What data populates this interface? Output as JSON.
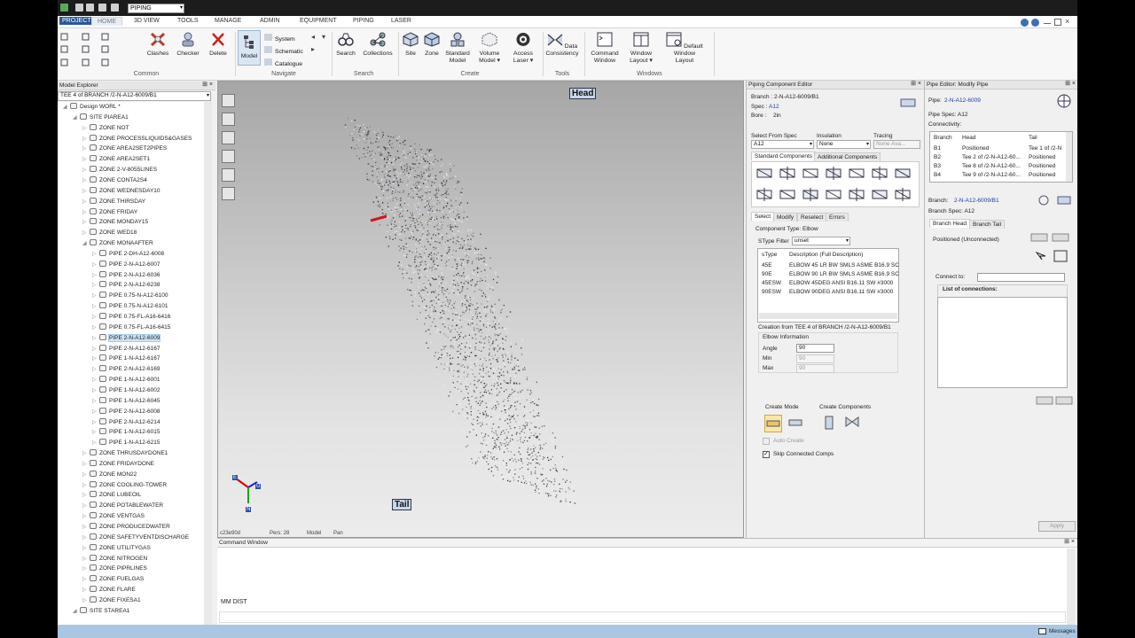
{
  "titlebar": {
    "project": "PIPING"
  },
  "menu": {
    "items": [
      "PROJECT",
      "HOME",
      "3D VIEW",
      "TOOLS",
      "MANAGE",
      "ADMIN",
      "EQUIPMENT",
      "PIPING",
      "LASER"
    ]
  },
  "ribbon": {
    "common_group": "Common",
    "navigate_group": "Navigate",
    "search_group": "Search",
    "create_group": "Create",
    "tools_group": "Tools",
    "windows_group": "Windows",
    "clashes": "Clashes",
    "checker": "Checker",
    "delete": "Delete",
    "model": "Model",
    "system": "System",
    "schematic": "Schematic",
    "catalogue": "Catalogue",
    "search": "Search",
    "collections": "Collections",
    "site": "Site",
    "zone": "Zone",
    "standard_model_1": "Standard",
    "standard_model_2": "Model",
    "volume_model_1": "Volume",
    "volume_model_2": "Model ▾",
    "access_laser_1": "Access",
    "access_laser_2": "Laser ▾",
    "data_consistency_1": "Data",
    "data_consistency_2": "Consistency",
    "command_window_1": "Command",
    "command_window_2": "Window",
    "window_layout_1": "Window",
    "window_layout_2": "Layout ▾",
    "default_window_layout_1": "Default Window",
    "default_window_layout_2": "Layout"
  },
  "explorer": {
    "title": "Model Explorer",
    "path": "TEE 4 of BRANCH /2-N-A12-6009/B1",
    "nodes": [
      {
        "label": "Design WORL *",
        "level": 0
      },
      {
        "label": "SITE PIAREA1",
        "level": 1
      },
      {
        "label": "ZONE NOT",
        "level": 2
      },
      {
        "label": "ZONE PROCESSLIQUIDS&GASES",
        "level": 2
      },
      {
        "label": "ZONE AREA2SET2PIPES",
        "level": 2
      },
      {
        "label": "ZONE AREA2SET1",
        "level": 2
      },
      {
        "label": "ZONE 2-V-8055LINES",
        "level": 2
      },
      {
        "label": "ZONE CONTA2S4",
        "level": 2
      },
      {
        "label": "ZONE WEDNESDAY10",
        "level": 2
      },
      {
        "label": "ZONE THIRSDAY",
        "level": 2
      },
      {
        "label": "ZONE FRIDAY",
        "level": 2
      },
      {
        "label": "ZONE MONDAY15",
        "level": 2
      },
      {
        "label": "ZONE WED18",
        "level": 2
      },
      {
        "label": "ZONE MONAAFTER",
        "level": 2
      },
      {
        "label": "PIPE 2-DH-A12-6008",
        "level": 3
      },
      {
        "label": "PIPE 2-N-A12-6007",
        "level": 3
      },
      {
        "label": "PIPE 2-N-A12-6036",
        "level": 3
      },
      {
        "label": "PIPE 2-N-A12-6238",
        "level": 3
      },
      {
        "label": "PIPE 0.75-N-A12-6100",
        "level": 3
      },
      {
        "label": "PIPE 0.75-N-A12-6101",
        "level": 3
      },
      {
        "label": "PIPE 0.75-FL-A16-6416",
        "level": 3
      },
      {
        "label": "PIPE 0.75-FL-A16-6415",
        "level": 3
      },
      {
        "label": "PIPE 2-N-A12-6009",
        "level": 3
      },
      {
        "label": "PIPE 2-N-A12-6167",
        "level": 3
      },
      {
        "label": "PIPE 1-N-A12-6167",
        "level": 3
      },
      {
        "label": "PIPE 2-N-A12-6169",
        "level": 3
      },
      {
        "label": "PIPE 1-N-A12-6001",
        "level": 3
      },
      {
        "label": "PIPE 1-N-A12-6002",
        "level": 3
      },
      {
        "label": "PIPE 1-N-A12-6045",
        "level": 3
      },
      {
        "label": "PIPE 2-N-A12-6008",
        "level": 3
      },
      {
        "label": "PIPE 2-N-A12-6214",
        "level": 3
      },
      {
        "label": "PIPE 1-N-A12-6015",
        "level": 3
      },
      {
        "label": "PIPE 1-N-A12-6215",
        "level": 3
      },
      {
        "label": "ZONE THRUSDAYDONE1",
        "level": 2
      },
      {
        "label": "ZONE FRIDAYDONE",
        "level": 2
      },
      {
        "label": "ZONE MON22",
        "level": 2
      },
      {
        "label": "ZONE COOLING-TOWER",
        "level": 2
      },
      {
        "label": "ZONE LUBEOIL",
        "level": 2
      },
      {
        "label": "ZONE POTABLEWATER",
        "level": 2
      },
      {
        "label": "ZONE VENTGAS",
        "level": 2
      },
      {
        "label": "ZONE PRODUCEDWATER",
        "level": 2
      },
      {
        "label": "ZONE SAFETYVENTDISCHARGE",
        "level": 2
      },
      {
        "label": "ZONE UTILITYGAS",
        "level": 2
      },
      {
        "label": "ZONE NITROGEN",
        "level": 2
      },
      {
        "label": "ZONE PIPRLINES",
        "level": 2
      },
      {
        "label": "ZONE FUELGAS",
        "level": 2
      },
      {
        "label": "ZONE FLARE",
        "level": 2
      },
      {
        "label": "ZONE FIXESA1",
        "level": 2
      },
      {
        "label": "SITE STAREA1",
        "level": 1
      }
    ]
  },
  "viewport": {
    "head_label": "Head",
    "tail_label": "Tail",
    "axis_e": "E",
    "axis_u": "U",
    "axis_n": "N",
    "status_coord": "c23e90d",
    "status_persp": "Pers: 28",
    "status_mode": "Model",
    "status_view": "Pan"
  },
  "component_editor": {
    "title": "Piping Component Editor",
    "branch_label": "Branch :",
    "branch_value": "2-N-A12-6009/B1",
    "spec_label": "Spec :",
    "spec_value": "A12",
    "bore_label": "Bore :",
    "bore_value": "2in",
    "select_from_spec": "Select From Spec",
    "insulation": "Insulation",
    "tracing": "Tracing",
    "spec_combo": "A12",
    "insulation_combo": "None",
    "tracing_combo": "None Ava...",
    "tab_standard": "Standard Components",
    "tab_additional": "Additional Components",
    "subtab_select": "Select",
    "subtab_modify": "Modify",
    "subtab_reselect": "Reselect",
    "subtab_errors": "Errors",
    "component_type": "Component Type: Elbow",
    "stype_filter": "SType Filter",
    "stype_value": "unset",
    "col_stype": "sType",
    "col_desc": "Description (Full Description)",
    "rows": [
      {
        "stype": "45E",
        "desc": "ELBOW 45 LR BW SMLS ASME B16.9 SC"
      },
      {
        "stype": "90E",
        "desc": "ELBOW 90 LR BW SMLS ASME B16.9 SC"
      },
      {
        "stype": "45ESW",
        "desc": "ELBOW 45DEG ANSI B16.11 SW #3000"
      },
      {
        "stype": "90ESW",
        "desc": "ELBOW 90DEG ANSI B16.11 SW #3000"
      }
    ],
    "creation_from": "Creation from TEE 4 of BRANCH /2-N-A12-6009/B1",
    "elbow_info": "Elbow Information",
    "angle_label": "Angle",
    "angle_value": "90",
    "min_label": "Min",
    "min_value": "90",
    "max_label": "Max",
    "max_value": "90",
    "create_mode": "Create Mode",
    "create_components": "Create Components",
    "auto_create": "Auto Create",
    "skip_connected": "Skip Connected Comps"
  },
  "pipe_editor": {
    "title": "Pipe Editor: Modify Pipe",
    "pipe_label": "Pipe:",
    "pipe_value": "2-N-A12-6009",
    "pipe_spec": "Pipe Spec: A12",
    "connectivity": "Connectivity:",
    "col_branch": "Branch",
    "col_head": "Head",
    "col_tail": "Tail",
    "rows": [
      {
        "branch": "B1",
        "head": "Positioned",
        "tail": "Tee 1 of /2-N"
      },
      {
        "branch": "B2",
        "head": "Tee 2 of /2-N-A12-60...",
        "tail": "Positioned"
      },
      {
        "branch": "B3",
        "head": "Tee 8 of /2-N-A12-60...",
        "tail": "Positioned"
      },
      {
        "branch": "B4",
        "head": "Tee 9 of /2-N-A12-60...",
        "tail": "Positioned"
      }
    ],
    "branch_label": "Branch:",
    "branch_value": "2-N-A12-6009/B1",
    "branch_spec": "Branch Spec: A12",
    "tab_head": "Branch Head",
    "tab_tail": "Branch Tail",
    "positioned": "Positioned (Unconnected)",
    "connect_to": "Connect to:",
    "list_connections": "List of connections:",
    "apply": "Apply"
  },
  "command_window": {
    "title": "Command Window",
    "text": "MM DIST"
  },
  "statusbar": {
    "messages": "Messages"
  }
}
